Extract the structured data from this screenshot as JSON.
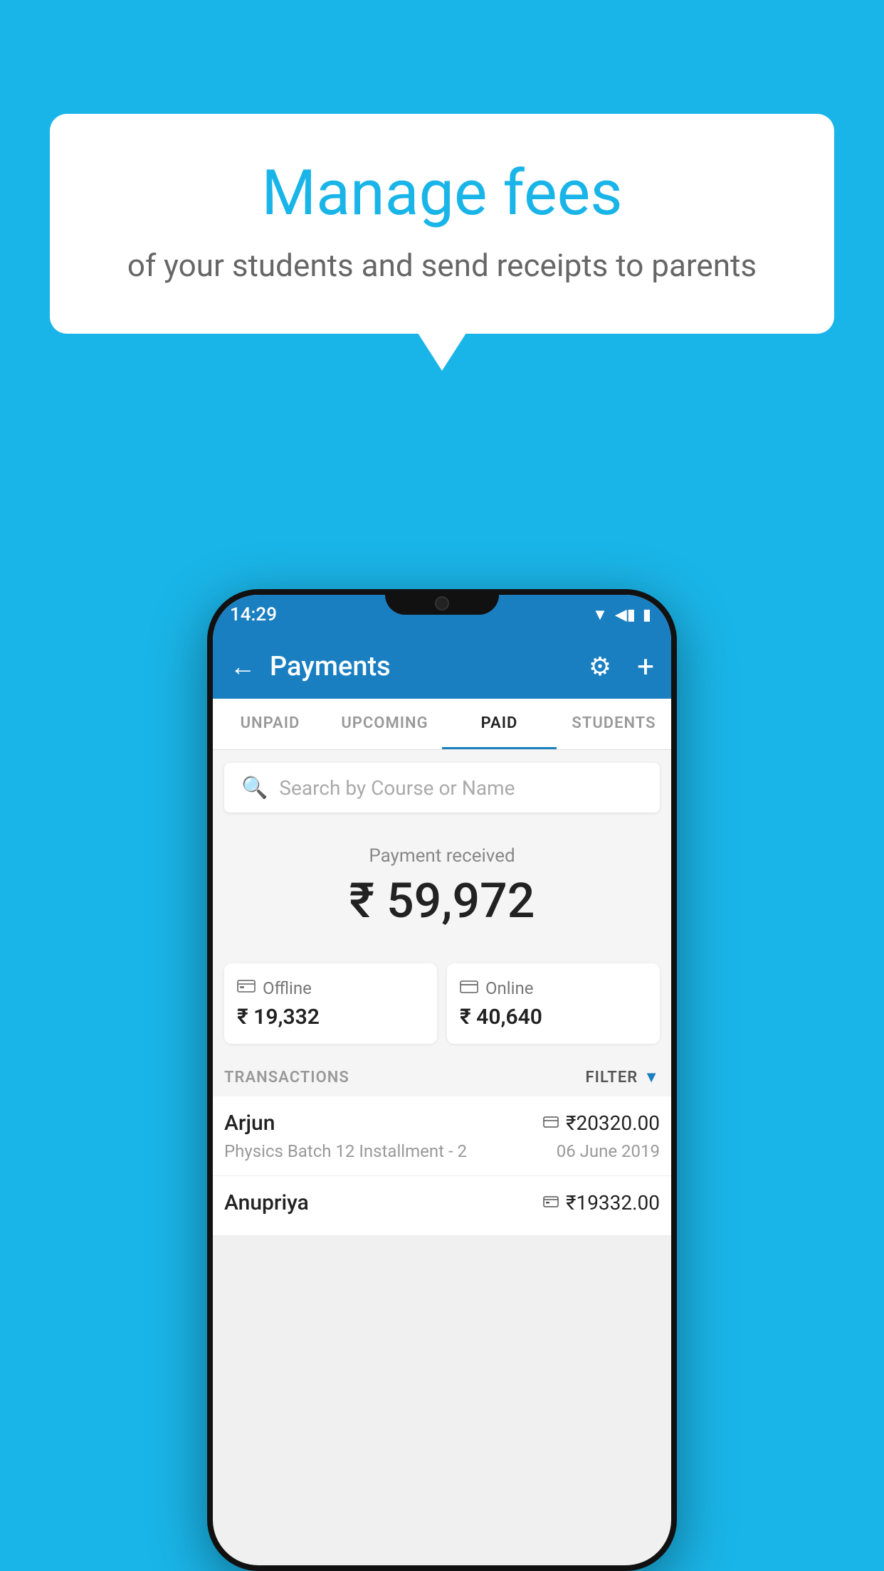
{
  "page": {
    "background_color": "#1ab5e8"
  },
  "speech_bubble": {
    "title": "Manage fees",
    "subtitle": "of your students and send receipts to parents"
  },
  "status_bar": {
    "time": "14:29",
    "wifi_icon": "▼",
    "signal_icon": "◀",
    "battery_icon": "▮"
  },
  "app_bar": {
    "title": "Payments",
    "back_label": "←",
    "settings_label": "⚙",
    "add_label": "+"
  },
  "tabs": [
    {
      "label": "UNPAID",
      "active": false
    },
    {
      "label": "UPCOMING",
      "active": false
    },
    {
      "label": "PAID",
      "active": true
    },
    {
      "label": "STUDENTS",
      "active": false
    }
  ],
  "search": {
    "placeholder": "Search by Course or Name"
  },
  "payment_summary": {
    "label": "Payment received",
    "amount": "₹ 59,972",
    "offline": {
      "icon": "💳",
      "label": "Offline",
      "amount": "₹ 19,332"
    },
    "online": {
      "icon": "💳",
      "label": "Online",
      "amount": "₹ 40,640"
    }
  },
  "transactions": {
    "label": "TRANSACTIONS",
    "filter_label": "FILTER",
    "items": [
      {
        "name": "Arjun",
        "description": "Physics Batch 12 Installment - 2",
        "amount": "₹20320.00",
        "date": "06 June 2019",
        "payment_type": "card"
      },
      {
        "name": "Anupriya",
        "description": "",
        "amount": "₹19332.00",
        "date": "",
        "payment_type": "cash"
      }
    ]
  }
}
